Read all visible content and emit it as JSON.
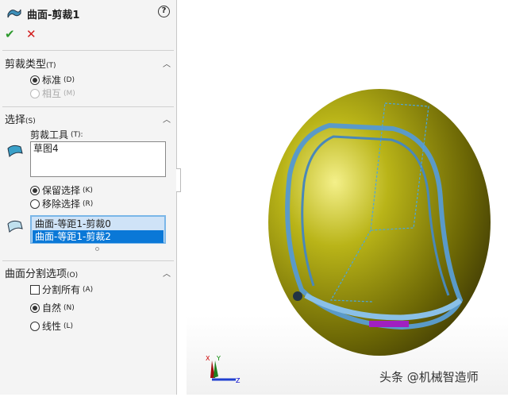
{
  "panel": {
    "title": "曲面-剪裁1",
    "help_icon": "?",
    "ok": "✔",
    "cancel": "✕",
    "trim_type": {
      "label": "剪裁类型",
      "key": "(T)",
      "options": [
        {
          "label": "标准",
          "key": "(D)",
          "selected": true,
          "disabled": false
        },
        {
          "label": "相互",
          "key": "(M)",
          "selected": false,
          "disabled": true
        }
      ]
    },
    "selection": {
      "label": "选择",
      "key": "(S)",
      "tool_label": "剪裁工具",
      "tool_key": "(T):",
      "tool_value": "草图4",
      "keep_options": [
        {
          "label": "保留选择",
          "key": "(K)",
          "selected": true
        },
        {
          "label": "移除选择",
          "key": "(R)",
          "selected": false
        }
      ],
      "surfaces": [
        {
          "label": "曲面-等距1-剪裁0",
          "selected": false
        },
        {
          "label": "曲面-等距1-剪裁2",
          "selected": true
        }
      ]
    },
    "split": {
      "label": "曲面分割选项",
      "key": "(O)",
      "split_all": {
        "label": "分割所有",
        "key": "(A)",
        "checked": false
      },
      "options": [
        {
          "label": "自然",
          "key": "(N)",
          "selected": true
        },
        {
          "label": "线性",
          "key": "(L)",
          "selected": false
        }
      ]
    }
  },
  "viewport": {
    "triad": {
      "x": "X",
      "y": "Y",
      "z": "Z"
    },
    "watermark": "头条 @机械智造师"
  }
}
